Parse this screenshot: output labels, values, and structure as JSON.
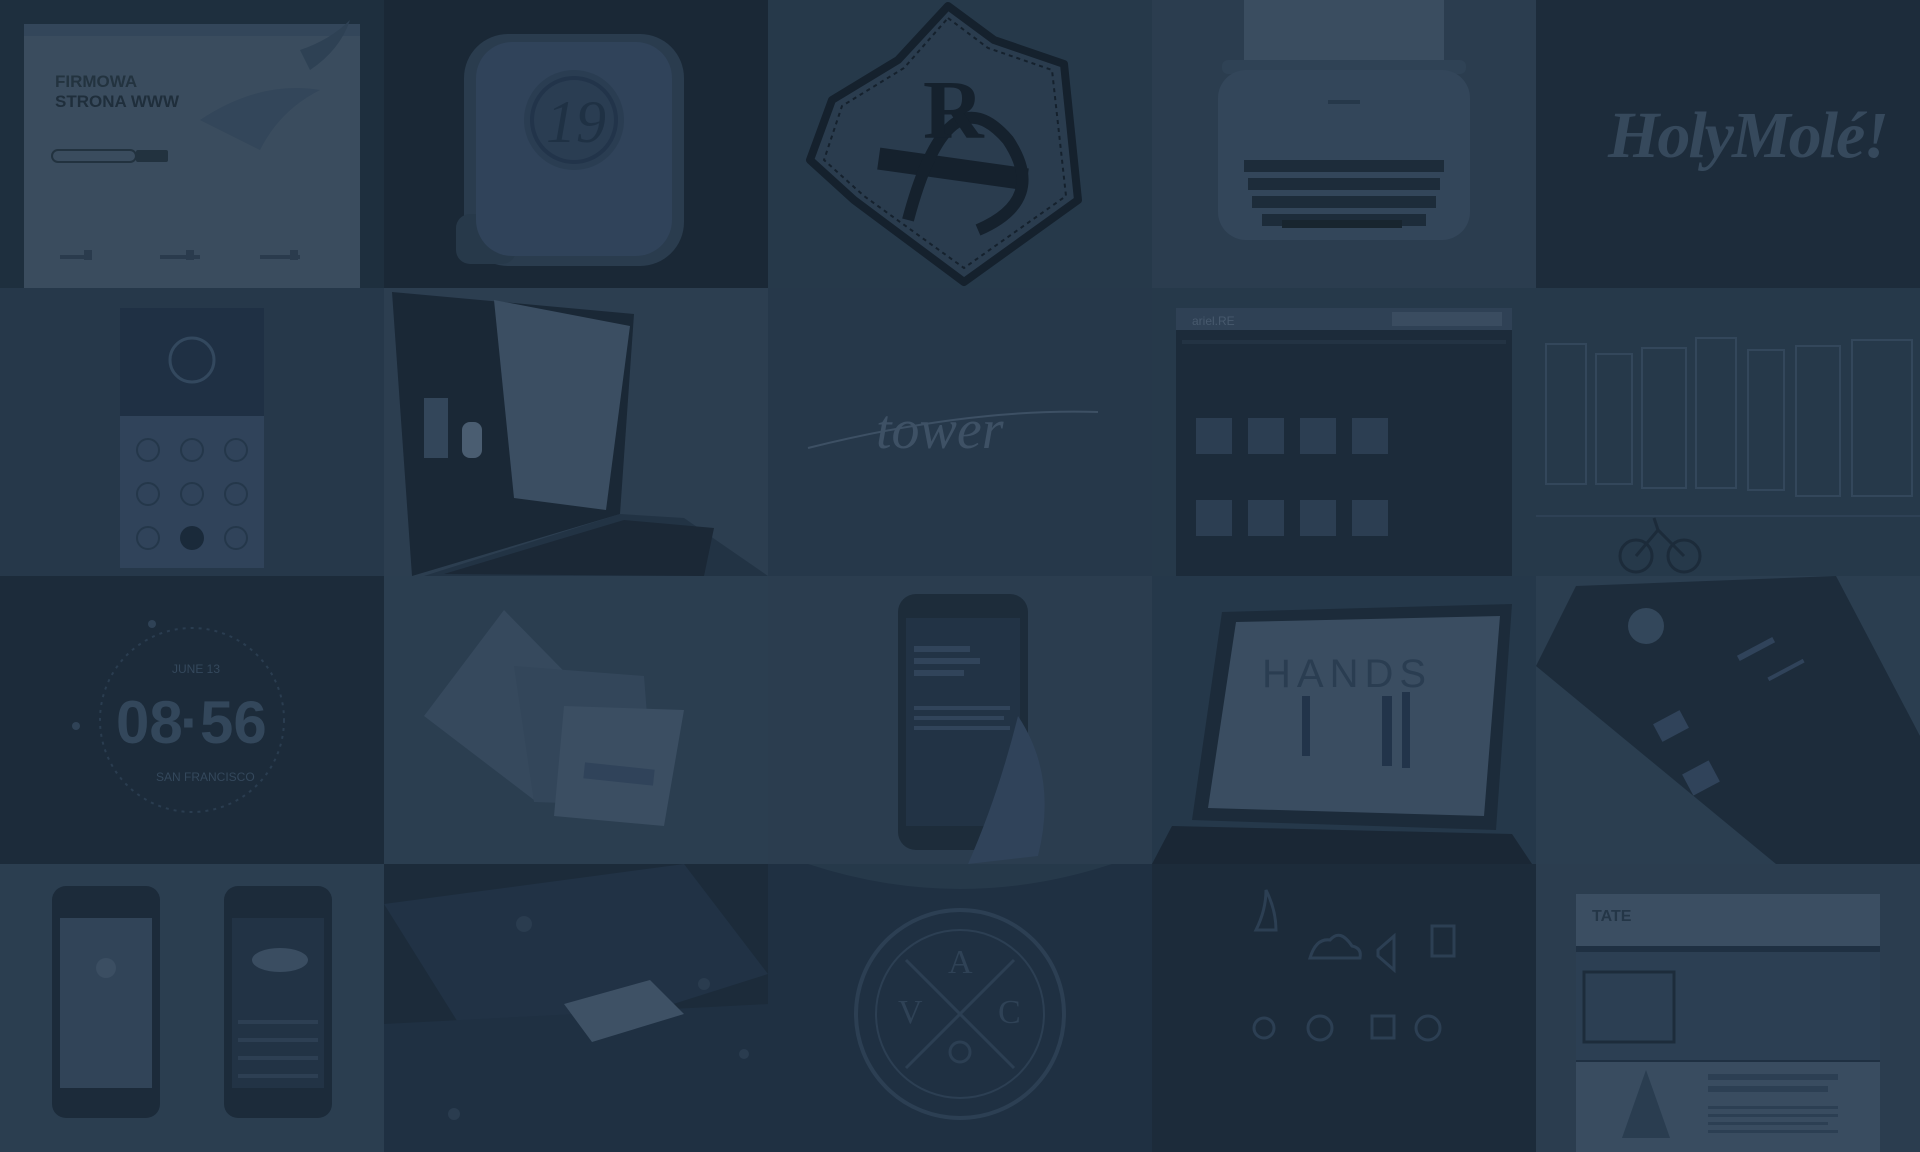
{
  "colors": {
    "overlay": "#1f3040",
    "tile_base": "#243646",
    "tile_dark": "#1c2b3a",
    "tile_light": "#2b3e50",
    "ink": "#16222e",
    "ink_soft": "#3a4f63"
  },
  "tiles": [
    {
      "id": "firmowa-strona-www",
      "texts": {
        "line1": "FIRMOWA",
        "line2": "STRONA WWW"
      },
      "icons": [
        "bird-icon",
        "bird-icon"
      ]
    },
    {
      "id": "ios-app-icon",
      "texts": {
        "monogram": "19"
      },
      "icons": [
        "app-icon"
      ]
    },
    {
      "id": "stitched-badge-logo",
      "texts": {
        "monogram": "R"
      },
      "icons": [
        "badge-icon"
      ]
    },
    {
      "id": "typewriter",
      "texts": {},
      "icons": [
        "typewriter-icon"
      ]
    },
    {
      "id": "holy-mole-lettering",
      "texts": {
        "logo": "HolyMolé!"
      },
      "icons": []
    },
    {
      "id": "mobile-icon-grid",
      "texts": {},
      "icons": [
        "globe-icon",
        "check-icon"
      ]
    },
    {
      "id": "laptop-document",
      "texts": {},
      "icons": [
        "laptop-icon"
      ]
    },
    {
      "id": "script-signature",
      "texts": {
        "signature": "tower"
      },
      "icons": []
    },
    {
      "id": "dark-web-store",
      "texts": {
        "brand": "ariel.RE"
      },
      "icons": []
    },
    {
      "id": "city-skyline-bike",
      "texts": {},
      "icons": [
        "bicycle-icon"
      ]
    },
    {
      "id": "clock-screen",
      "texts": {
        "date": "JUNE 13",
        "hours": "08",
        "minutes": "56",
        "city": "SAN FRANCISCO"
      },
      "icons": [
        "clock-icon"
      ]
    },
    {
      "id": "brochure-stationery",
      "texts": {},
      "icons": [
        "brochure-icon"
      ]
    },
    {
      "id": "phone-in-hand",
      "texts": {},
      "icons": [
        "phone-icon"
      ]
    },
    {
      "id": "laptop-fashion-site",
      "texts": {
        "heading": "HANDS"
      },
      "icons": [
        "laptop-icon"
      ]
    },
    {
      "id": "phone-card-app",
      "texts": {},
      "icons": [
        "phone-icon",
        "person-icon"
      ]
    },
    {
      "id": "two-phones-weather",
      "texts": {},
      "icons": [
        "cloud-icon",
        "sun-icon"
      ]
    },
    {
      "id": "dark-dashboard",
      "texts": {},
      "icons": [
        "card-icon"
      ]
    },
    {
      "id": "vac-badge-tshirt",
      "texts": {
        "letter_a": "A",
        "letter_v": "V",
        "letter_c": "C"
      },
      "icons": [
        "badge-icon"
      ]
    },
    {
      "id": "line-icon-set",
      "texts": {},
      "icons": [
        "rocket-icon",
        "cloud-icon",
        "speaker-icon",
        "document-icon",
        "lightbulb-icon",
        "globe-icon",
        "calendar-icon",
        "target-icon"
      ]
    },
    {
      "id": "pine-tree-website",
      "texts": {
        "logo": "TATE"
      },
      "icons": [
        "tree-icon"
      ]
    }
  ]
}
